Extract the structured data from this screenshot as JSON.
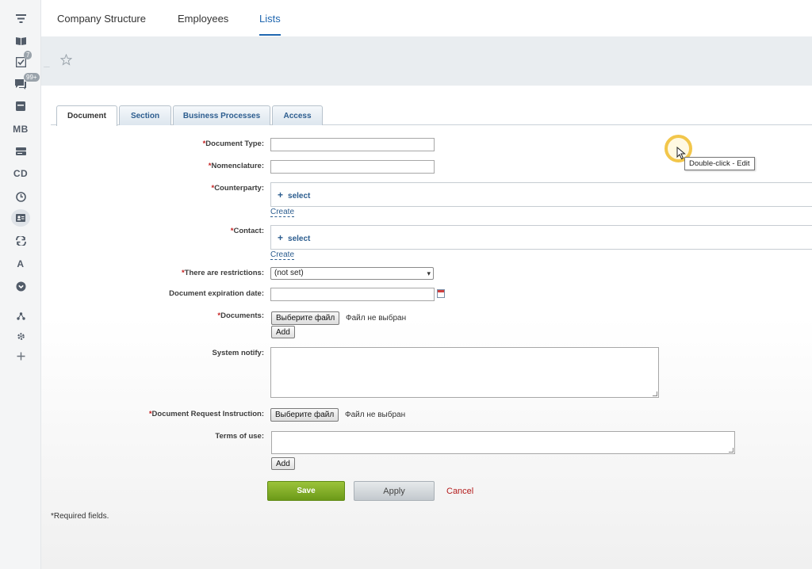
{
  "sidebar": {
    "badges": {
      "tasks": "7",
      "chat": "99+"
    },
    "text_items": {
      "mb": "MB",
      "cd": "CD",
      "a": "A"
    }
  },
  "topnav": {
    "items": [
      "Company Structure",
      "Employees",
      "Lists"
    ],
    "active": "Lists"
  },
  "title": {
    "dots": "...."
  },
  "tabs": [
    "Document",
    "Section",
    "Business Processes",
    "Access"
  ],
  "form": {
    "document_type_label": "Document Type:",
    "nomenclature_label": "Nomenclature:",
    "counterparty_label": "Counterparty:",
    "contact_label": "Contact:",
    "select_link": "select",
    "create_link": "Create",
    "restrictions_label": "There are restrictions:",
    "restrictions_value": "(not set)",
    "expiration_label": "Document expiration date:",
    "documents_label": "Documents:",
    "file_button": "Выберите файл",
    "file_status": "Файл не выбран",
    "add_button": "Add",
    "system_notify_label": "System notify:",
    "instruction_label": "Document Request Instruction:",
    "terms_label": "Terms of use:",
    "required_mark": "*"
  },
  "buttons": {
    "save": "Save",
    "apply": "Apply",
    "cancel": "Cancel"
  },
  "required_note": "*Required fields.",
  "tooltip": "Double-click - Edit",
  "colors": {
    "accent": "#2067b0",
    "save_green": "#7aa823",
    "cancel_red": "#b41c1c",
    "required_red": "#c41e1e",
    "cursor_highlight": "#f2c64a"
  }
}
